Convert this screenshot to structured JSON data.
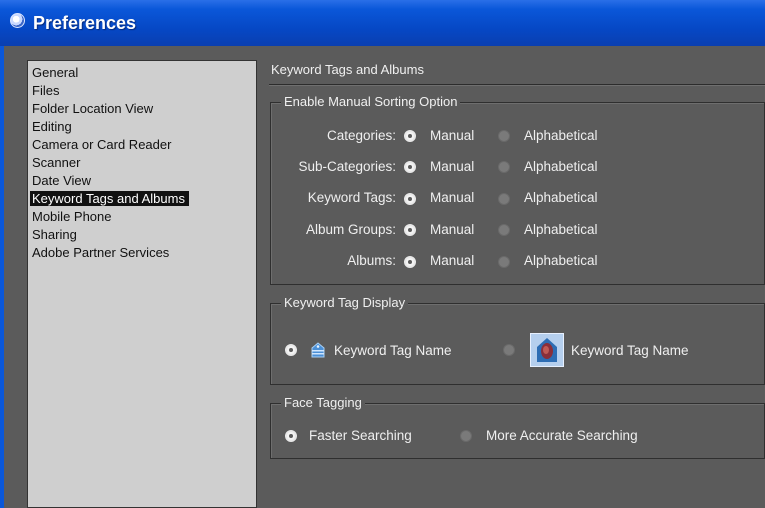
{
  "window": {
    "title": "Preferences",
    "icon": "camera-icon"
  },
  "sidebar": {
    "items": [
      {
        "label": "General"
      },
      {
        "label": "Files"
      },
      {
        "label": "Folder Location View"
      },
      {
        "label": "Editing"
      },
      {
        "label": "Camera or Card Reader"
      },
      {
        "label": "Scanner"
      },
      {
        "label": "Date View"
      },
      {
        "label": "Keyword Tags and Albums",
        "selected": true
      },
      {
        "label": "Mobile Phone"
      },
      {
        "label": "Sharing"
      },
      {
        "label": "Adobe Partner Services"
      }
    ]
  },
  "main": {
    "title": "Keyword Tags and Albums",
    "sorting": {
      "legend": "Enable Manual Sorting Option",
      "option_manual": "Manual",
      "option_alpha": "Alphabetical",
      "rows": [
        {
          "label": "Categories:",
          "selected": "manual"
        },
        {
          "label": "Sub-Categories:",
          "selected": "manual"
        },
        {
          "label": "Keyword Tags:",
          "selected": "manual"
        },
        {
          "label": "Album Groups:",
          "selected": "manual"
        },
        {
          "label": "Albums:",
          "selected": "manual"
        }
      ]
    },
    "tag_display": {
      "legend": "Keyword Tag Display",
      "option1_label": "Keyword Tag Name",
      "option1_icon": "tag-icon",
      "option2_label": "Keyword Tag Name",
      "option2_icon": "face-thumbnail-icon",
      "selected": 1
    },
    "face_tagging": {
      "legend": "Face Tagging",
      "option1_label": "Faster Searching",
      "option2_label": "More Accurate Searching",
      "selected": 1
    }
  },
  "colors": {
    "titlebar": "#0a57d9",
    "panel": "#5b5b5b",
    "sidebar": "#cfcfcf"
  }
}
